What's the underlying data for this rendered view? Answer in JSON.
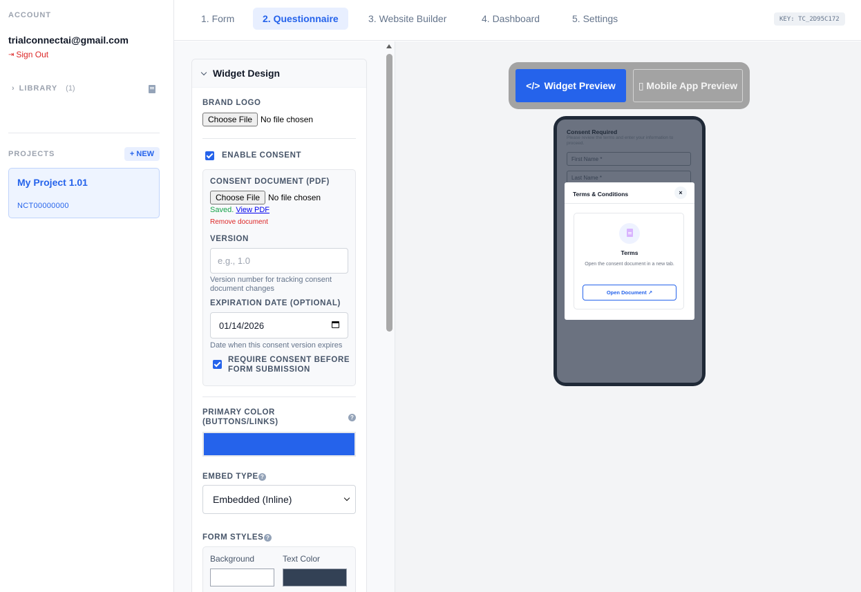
{
  "sidebar": {
    "account_label": "ACCOUNT",
    "email": "trialconnectai@gmail.com",
    "signout": "Sign Out",
    "library_label": "LIBRARY",
    "library_count": "(1)",
    "projects_label": "PROJECTS",
    "new_button": "+ NEW",
    "project": {
      "name": "My Project 1.01",
      "id": "NCT00000000"
    }
  },
  "nav": {
    "tabs": [
      "1. Form",
      "2. Questionnaire",
      "3. Website Builder",
      "4. Dashboard",
      "5. Settings"
    ],
    "active_tab": "2. Questionnaire",
    "key": "KEY: TC_2D95C172"
  },
  "form": {
    "section_title": "Widget Design",
    "brand_logo_label": "BRAND LOGO",
    "choose_file": "Choose File",
    "no_file": "No file chosen",
    "enable_consent_label": "ENABLE CONSENT",
    "enable_consent_checked": true,
    "consent_doc_label": "CONSENT DOCUMENT (PDF)",
    "saved_text": "Saved.",
    "view_pdf": "View PDF",
    "remove_doc": "Remove document",
    "version_label": "VERSION",
    "version_placeholder": "e.g., 1.0",
    "version_hint": "Version number for tracking consent document changes",
    "expiration_label": "EXPIRATION DATE (OPTIONAL)",
    "expiration_value": "01/14/2026",
    "expiration_hint": "Date when this consent version expires",
    "require_consent_label": "REQUIRE CONSENT BEFORE FORM SUBMISSION",
    "require_consent_checked": true,
    "primary_color_label": "PRIMARY COLOR (BUTTONS/LINKS)",
    "primary_color": "#2563eb",
    "embed_type_label": "EMBED TYPE",
    "embed_type_value": "Embedded (Inline)",
    "form_styles_label": "FORM STYLES",
    "background_label": "Background",
    "background_color": "#ffffff",
    "text_color_label": "Text Color",
    "text_color": "#334155"
  },
  "preview": {
    "widget_preview": "Widget Preview",
    "mobile_preview": "Mobile App Preview",
    "phone": {
      "consent_title": "Consent Required",
      "consent_sub": "Please review the terms and enter your information to proceed.",
      "first_name": "First Name *",
      "last_name": "Last Name *",
      "modal_title": "Terms & Conditions",
      "close": "×",
      "terms_title": "Terms",
      "terms_desc": "Open the consent document in a new tab.",
      "open_doc": "Open Document ↗"
    }
  }
}
